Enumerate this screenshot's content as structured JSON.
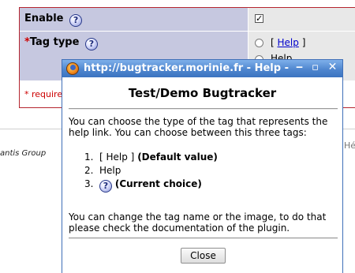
{
  "config": {
    "enable_label": "Enable",
    "enable_checked": true,
    "checkbox_mark": "✓",
    "tag_type_required_mark": "*",
    "tag_type_label": "Tag type",
    "help_badge_glyph": "?",
    "radio_option_1_open": "[",
    "radio_option_1_link": "Help",
    "radio_option_1_close": "]",
    "radio_option_2_partial": "Help",
    "required_note": "* required"
  },
  "footer": {
    "left_text": "antis Group",
    "right_text": "Hé"
  },
  "popup": {
    "title": "http://bugtracker.morinie.fr - Help -",
    "minimize_glyph": "‒",
    "maximize_glyph": "▫",
    "close_glyph": "✕",
    "heading": "Test/Demo Bugtracker",
    "intro": "You can choose the type of the tag that represents the help link. You can choose between this three tags:",
    "options": [
      {
        "num": "1.",
        "text": "[ Help ]",
        "note": "(Default value)"
      },
      {
        "num": "2.",
        "text": "Help",
        "note": ""
      },
      {
        "num": "3.",
        "icon": "help-question-icon",
        "note": "(Current choice)"
      }
    ],
    "outro": "You can change the tag name or the image, to do that please check the documentation of the plugin.",
    "close_button": "Close"
  },
  "colors": {
    "label_cell_bg": "#c6c8e0",
    "value_cell_bg": "#e8e8e8",
    "border_red": "#b5252f",
    "titlebar_blue": "#4f86cf",
    "link_blue": "#0000cc"
  }
}
